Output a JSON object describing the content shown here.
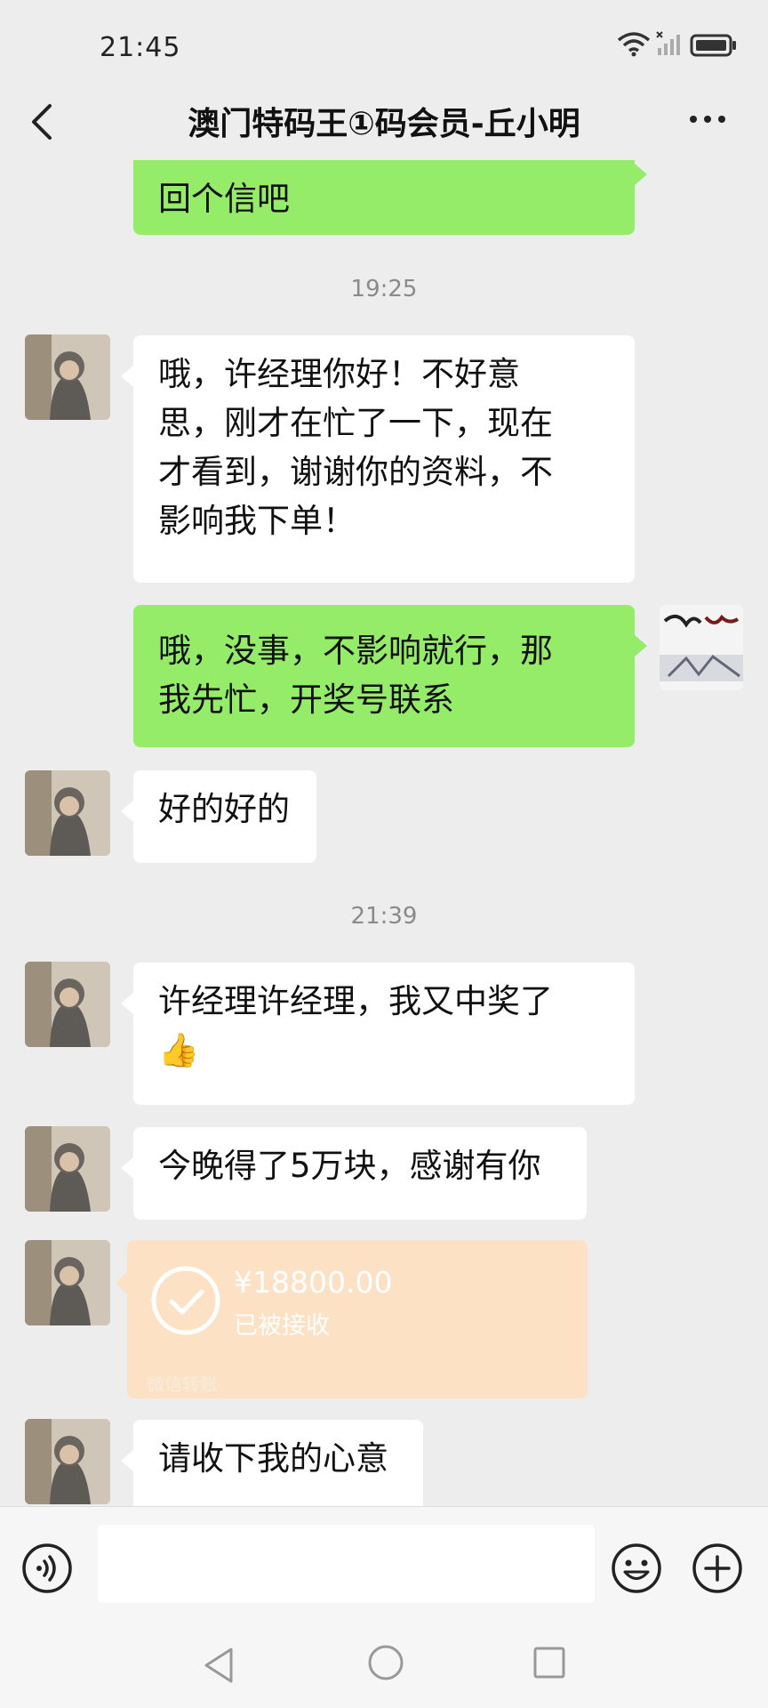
{
  "status_bar": {
    "time": "21:45"
  },
  "header": {
    "title": "澳门特码王①码会员-丘小明"
  },
  "messages": {
    "m0": {
      "text": "回个信吧"
    },
    "ts1": "19:25",
    "m1": {
      "text": "哦，许经理你好！不好意\n思，刚才在忙了一下，现在\n才看到，谢谢你的资料，不\n影响我下单！"
    },
    "m2": {
      "text": "哦，没事，不影响就行，那\n我先忙，开奖号联系"
    },
    "m3": {
      "text": "好的好的"
    },
    "ts2": "21:39",
    "m4": {
      "text": "许经理许经理，我又中奖了\n👍"
    },
    "m5": {
      "text": "今晚得了5万块，感谢有你"
    },
    "transfer": {
      "amount": "¥18800.00",
      "status": "已被接收",
      "footer": "微信转账"
    },
    "m7": {
      "text": "请收下我的心意"
    }
  },
  "colors": {
    "incoming": "#ffffff",
    "outgoing": "#95ec69",
    "transfer": "#fde1c5",
    "background": "#ededed"
  },
  "icons": [
    "back-icon",
    "more-icon",
    "voice-icon",
    "emoji-icon",
    "plus-icon",
    "check-icon"
  ]
}
